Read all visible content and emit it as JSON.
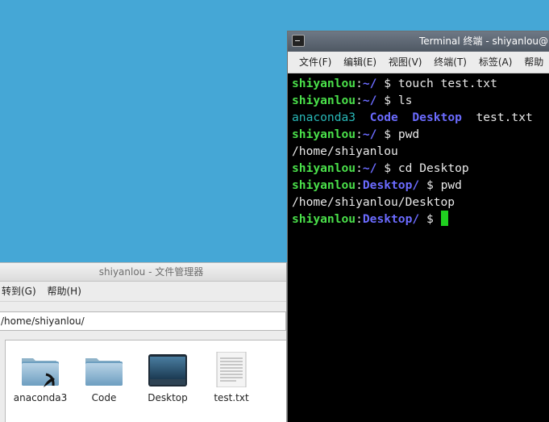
{
  "file_manager": {
    "title": "shiyanlou - 文件管理器",
    "menu": [
      "转到(G)",
      "帮助(H)"
    ],
    "path": "/home/shiyanlou/",
    "items": [
      {
        "label": "anaconda3",
        "icon": "folder-link-icon"
      },
      {
        "label": "Code",
        "icon": "folder-icon"
      },
      {
        "label": "Desktop",
        "icon": "desktop-folder-icon"
      },
      {
        "label": "test.txt",
        "icon": "text-file-icon"
      }
    ]
  },
  "terminal": {
    "title": "Terminal 终端 - shiyanlou@",
    "menu": [
      "文件(F)",
      "编辑(E)",
      "视图(V)",
      "终端(T)",
      "标签(A)",
      "帮助"
    ],
    "prompt_user": "shiyanlou",
    "home": "~/",
    "desktop_dir": "Desktop/",
    "dollar": "$",
    "cmd1": "touch test.txt",
    "cmd2": "ls",
    "ls_anaconda": "anaconda3",
    "ls_code": "Code",
    "ls_desktop": "Desktop",
    "ls_test": "test.txt",
    "cmd3": "pwd",
    "out3": "/home/shiyanlou",
    "cmd4": "cd Desktop",
    "cmd5": "pwd",
    "out5": "/home/shiyanlou/Desktop"
  },
  "colors": {
    "desktop_bg": "#45a7d6",
    "prompt_green": "#4ae04a",
    "dir_blue": "#6b6bff",
    "link_cyan": "#28b8b8"
  }
}
